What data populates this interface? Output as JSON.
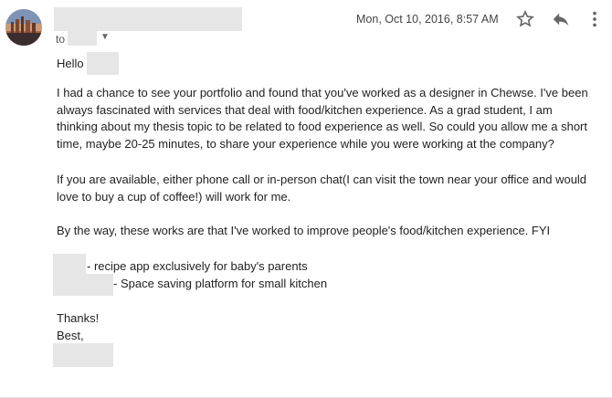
{
  "header": {
    "to_label": "to",
    "date": "Mon, Oct 10, 2016, 8:57 AM"
  },
  "icons": {
    "star": "star-icon",
    "reply": "reply-icon",
    "more": "more-vert-icon",
    "expand": "chevron-down-icon"
  },
  "body": {
    "greeting": "Hello",
    "paragraphs": [
      "I had a chance to see your portfolio and found that you've worked as a designer in Chewse. I've been always fascinated with services that deal with food/kitchen experience. As a grad student, I am thinking about my thesis topic to be related to food experience as well. So could you allow me a short time, maybe 20-25 minutes, to share your experience while you were working at the company?",
      "If you are available, either phone call or in-person chat(I can visit the town near your office and would love to buy a cup of coffee!) will work for me.",
      "By the way, these works are that I've worked to improve people's food/kitchen experience. FYI"
    ],
    "works": [
      " - recipe app exclusively for baby's parents",
      " - Space saving platform for small kitchen"
    ],
    "closing_1": "Thanks!",
    "closing_2": "Best,"
  }
}
